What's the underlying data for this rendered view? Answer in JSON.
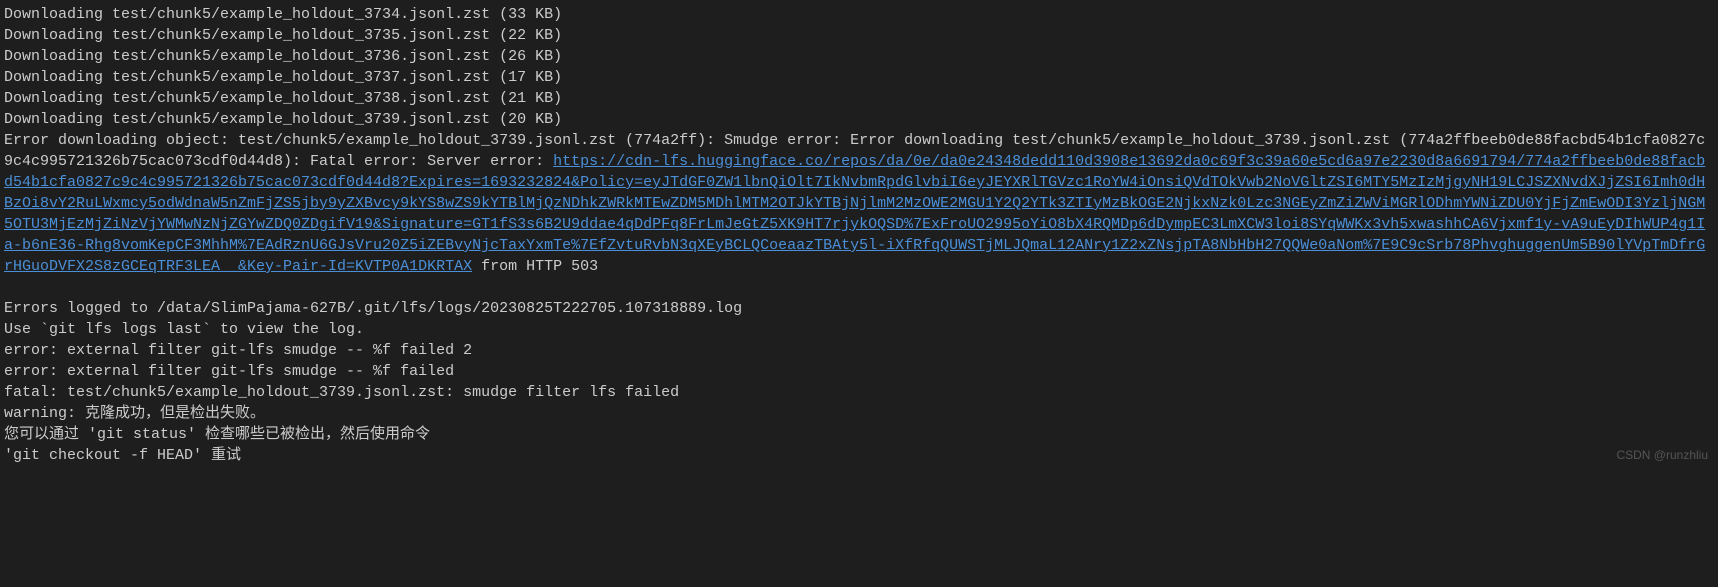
{
  "downloads": [
    "Downloading test/chunk5/example_holdout_3734.jsonl.zst (33 KB)",
    "Downloading test/chunk5/example_holdout_3735.jsonl.zst (22 KB)",
    "Downloading test/chunk5/example_holdout_3736.jsonl.zst (26 KB)",
    "Downloading test/chunk5/example_holdout_3737.jsonl.zst (17 KB)",
    "Downloading test/chunk5/example_holdout_3738.jsonl.zst (21 KB)",
    "Downloading test/chunk5/example_holdout_3739.jsonl.zst (20 KB)"
  ],
  "error_prefix": "Error downloading object: test/chunk5/example_holdout_3739.jsonl.zst (774a2ff): Smudge error: Error downloading test/chunk5/example_holdout_3739.jsonl.zst (774a2ffbeeb0de88facbd54b1cfa0827c9c4c995721326b75cac073cdf0d44d8): Fatal error: Server error: ",
  "error_url": "https://cdn-lfs.huggingface.co/repos/da/0e/da0e24348dedd110d3908e13692da0c69f3c39a60e5cd6a97e2230d8a6691794/774a2ffbeeb0de88facbd54b1cfa0827c9c4c995721326b75cac073cdf0d44d8?Expires=1693232824&Policy=eyJTdGF0ZW1lbnQiOlt7IkNvbmRpdGlvbiI6eyJEYXRlTGVzc1RoYW4iOnsiQVdTOkVwb2NoVGltZSI6MTY5MzIzMjgyNH19LCJSZXNvdXJjZSI6Imh0dHBzOi8vY2RuLWxmcy5odWdnaW5nZmFjZS5jby9yZXBvcy9kYS8wZS9kYTBlMjQzNDhkZWRkMTEwZDM5MDhlMTM2OTJkYTBjNjlmM2MzOWE2MGU1Y2Q2YTk3ZTIyMzBkOGE2NjkxNzk0Lzc3NGEyZmZiZWViMGRlODhmYWNiZDU0YjFjZmEwODI3YzljNGM5OTU3MjEzMjZiNzVjYWMwNzNjZGYwZDQ0ZDgifV19&Signature=GT1fS3s6B2U9ddae4qDdPFq8FrLmJeGtZ5XK9HT7rjykOQSD%7ExFroUO2995oYiO8bX4RQMDp6dDympEC3LmXCW3loi8SYqWWKx3vh5xwashhCA6Vjxmf1y-vA9uEyDIhWUP4g1Ia-b6nE36-Rhg8vomKepCF3MhhM%7EAdRznU6GJsVru20Z5iZEBvyNjcTaxYxmTe%7EfZvtuRvbN3qXEyBCLQCoeaazTBAty5l-iXfRfqQUWSTjMLJQmaL12ANry1Z2xZNsjpTA8NbHbH27QQWe0aNom%7E9C9cSrb78PhvghuggenUm5B90lYVpTmDfrGrHGuoDVFX2S8zGCEqTRF3LEA__&Key-Pair-Id=KVTP0A1DKRTAX",
  "error_suffix": " from HTTP 503",
  "log_lines": [
    "Errors logged to /data/SlimPajama-627B/.git/lfs/logs/20230825T222705.107318889.log",
    "Use `git lfs logs last` to view the log.",
    "error: external filter git-lfs smudge -- %f failed 2",
    "error: external filter git-lfs smudge -- %f failed",
    "fatal: test/chunk5/example_holdout_3739.jsonl.zst: smudge filter lfs failed",
    "warning: 克隆成功，但是检出失败。",
    "您可以通过 'git status' 检查哪些已被检出，然后使用命令",
    "'git checkout -f HEAD' 重试"
  ],
  "watermark": "CSDN @runzhliu"
}
